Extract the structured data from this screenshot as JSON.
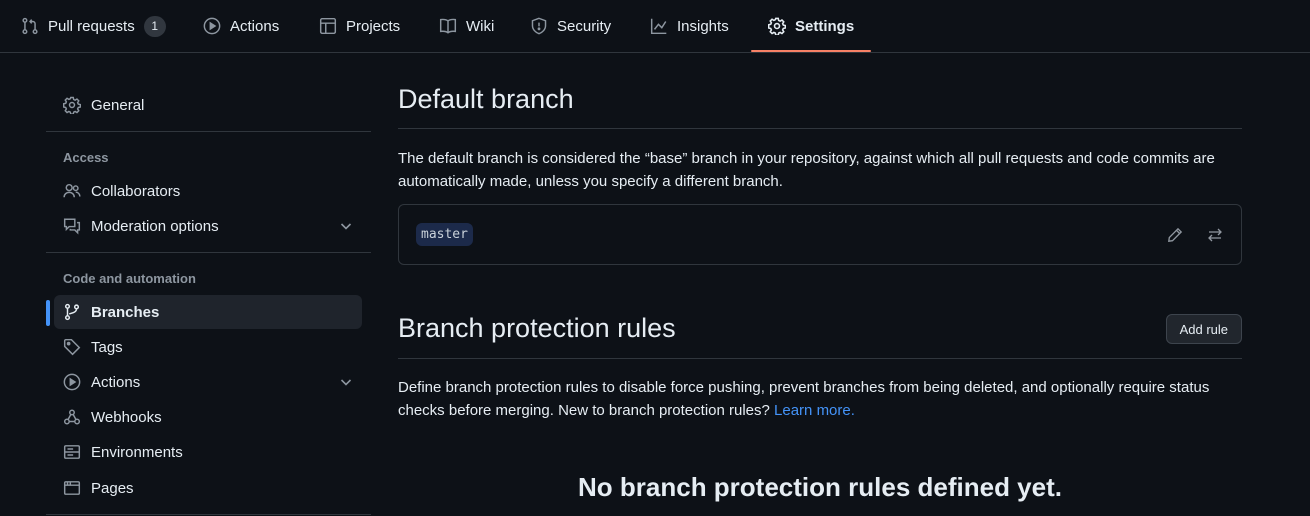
{
  "topnav": {
    "tabs": [
      {
        "label": "Pull requests",
        "icon": "git-pull-request-icon",
        "counter": "1"
      },
      {
        "label": "Actions",
        "icon": "play-icon"
      },
      {
        "label": "Projects",
        "icon": "table-icon"
      },
      {
        "label": "Wiki",
        "icon": "book-icon"
      },
      {
        "label": "Security",
        "icon": "shield-icon"
      },
      {
        "label": "Insights",
        "icon": "graph-icon"
      },
      {
        "label": "Settings",
        "icon": "gear-icon",
        "selected": true
      }
    ],
    "selected_underline_color": "#f78166"
  },
  "sidebar": {
    "general": "General",
    "access_heading": "Access",
    "collaborators": "Collaborators",
    "moderation": "Moderation options",
    "code_heading": "Code and automation",
    "branches": "Branches",
    "tags": "Tags",
    "actions": "Actions",
    "webhooks": "Webhooks",
    "environments": "Environments",
    "pages": "Pages",
    "active_item": "Branches",
    "active_color": "#4493f8"
  },
  "default_branch": {
    "title": "Default branch",
    "description": "The default branch is considered the “base” branch in your repository, against which all pull requests and code commits are automatically made, unless you specify a different branch.",
    "branch_name": "master",
    "edit_icon": "pencil-icon",
    "switch_icon": "arrow-switch-icon"
  },
  "protection": {
    "title": "Branch protection rules",
    "add_rule": "Add rule",
    "description": "Define branch protection rules to disable force pushing, prevent branches from being deleted, and optionally require status checks before merging. New to branch protection rules?",
    "learn_more": "Learn more.",
    "empty_title": "No branch protection rules defined yet."
  },
  "colors": {
    "background": "#0d1117",
    "border": "#30363d",
    "link": "#4493f8"
  }
}
